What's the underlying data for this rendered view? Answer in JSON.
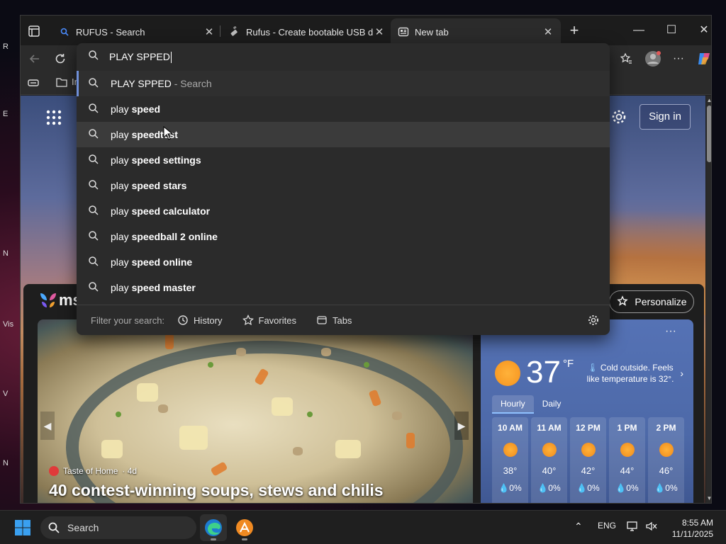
{
  "desktop": {
    "edge_labels": [
      "R",
      "E",
      "N",
      "Vis",
      "V",
      "N"
    ]
  },
  "tabs": [
    {
      "label": "RUFUS - Search",
      "icon": "search-icon"
    },
    {
      "label": "Rufus - Create bootable USB drive",
      "icon": "usb-icon"
    },
    {
      "label": "New tab",
      "icon": "newtab-icon"
    }
  ],
  "window_controls": {
    "minimize": "—",
    "maximize": "☐",
    "close": "✕"
  },
  "favorites_bar": {
    "item_label": "In"
  },
  "omnibox": {
    "query": "PLAY SPPED",
    "suggestions": [
      {
        "normal": "PLAY SPPED",
        "bold": "",
        "hint": " - Search"
      },
      {
        "normal": "play ",
        "bold": "speed",
        "hint": ""
      },
      {
        "normal": "play ",
        "bold": "speedtest",
        "hint": ""
      },
      {
        "normal": "play ",
        "bold": "speed settings",
        "hint": ""
      },
      {
        "normal": "play ",
        "bold": "speed stars",
        "hint": ""
      },
      {
        "normal": "play ",
        "bold": "speed calculator",
        "hint": ""
      },
      {
        "normal": "play ",
        "bold": "speedball 2 online",
        "hint": ""
      },
      {
        "normal": "play ",
        "bold": "speed online",
        "hint": ""
      },
      {
        "normal": "play ",
        "bold": "speed master",
        "hint": ""
      }
    ],
    "footer": {
      "filter_label": "Filter your search:",
      "chips": [
        {
          "label": "History",
          "icon": "history-icon"
        },
        {
          "label": "Favorites",
          "icon": "star-icon"
        },
        {
          "label": "Tabs",
          "icon": "tabs-icon"
        }
      ]
    }
  },
  "newtab": {
    "signin_label": "Sign in",
    "msn_text": "ms",
    "personalize_label": "Personalize",
    "hero": {
      "source": "Taste of Home",
      "age": "· 4d",
      "title": "40 contest-winning soups, stews and chilis"
    },
    "weather": {
      "more": "···",
      "temp": "37",
      "unit": "°F",
      "note": "Cold outside. Feels like temperature is 32°.",
      "tabs": [
        "Hourly",
        "Daily"
      ],
      "hours": [
        {
          "time": "10 AM",
          "temp": "38°",
          "precip": "0%"
        },
        {
          "time": "11 AM",
          "temp": "40°",
          "precip": "0%"
        },
        {
          "time": "12 PM",
          "temp": "42°",
          "precip": "0%"
        },
        {
          "time": "1 PM",
          "temp": "44°",
          "precip": "0%"
        },
        {
          "time": "2 PM",
          "temp": "46°",
          "precip": "0%"
        }
      ]
    }
  },
  "taskbar": {
    "search_label": "Search",
    "language": "ENG",
    "time": "8:55 AM",
    "date": "11/11/2025"
  },
  "colors": {
    "accent": "#6f8fd8",
    "sun": "#f5921e",
    "weather_bg": "#4d69a8"
  }
}
